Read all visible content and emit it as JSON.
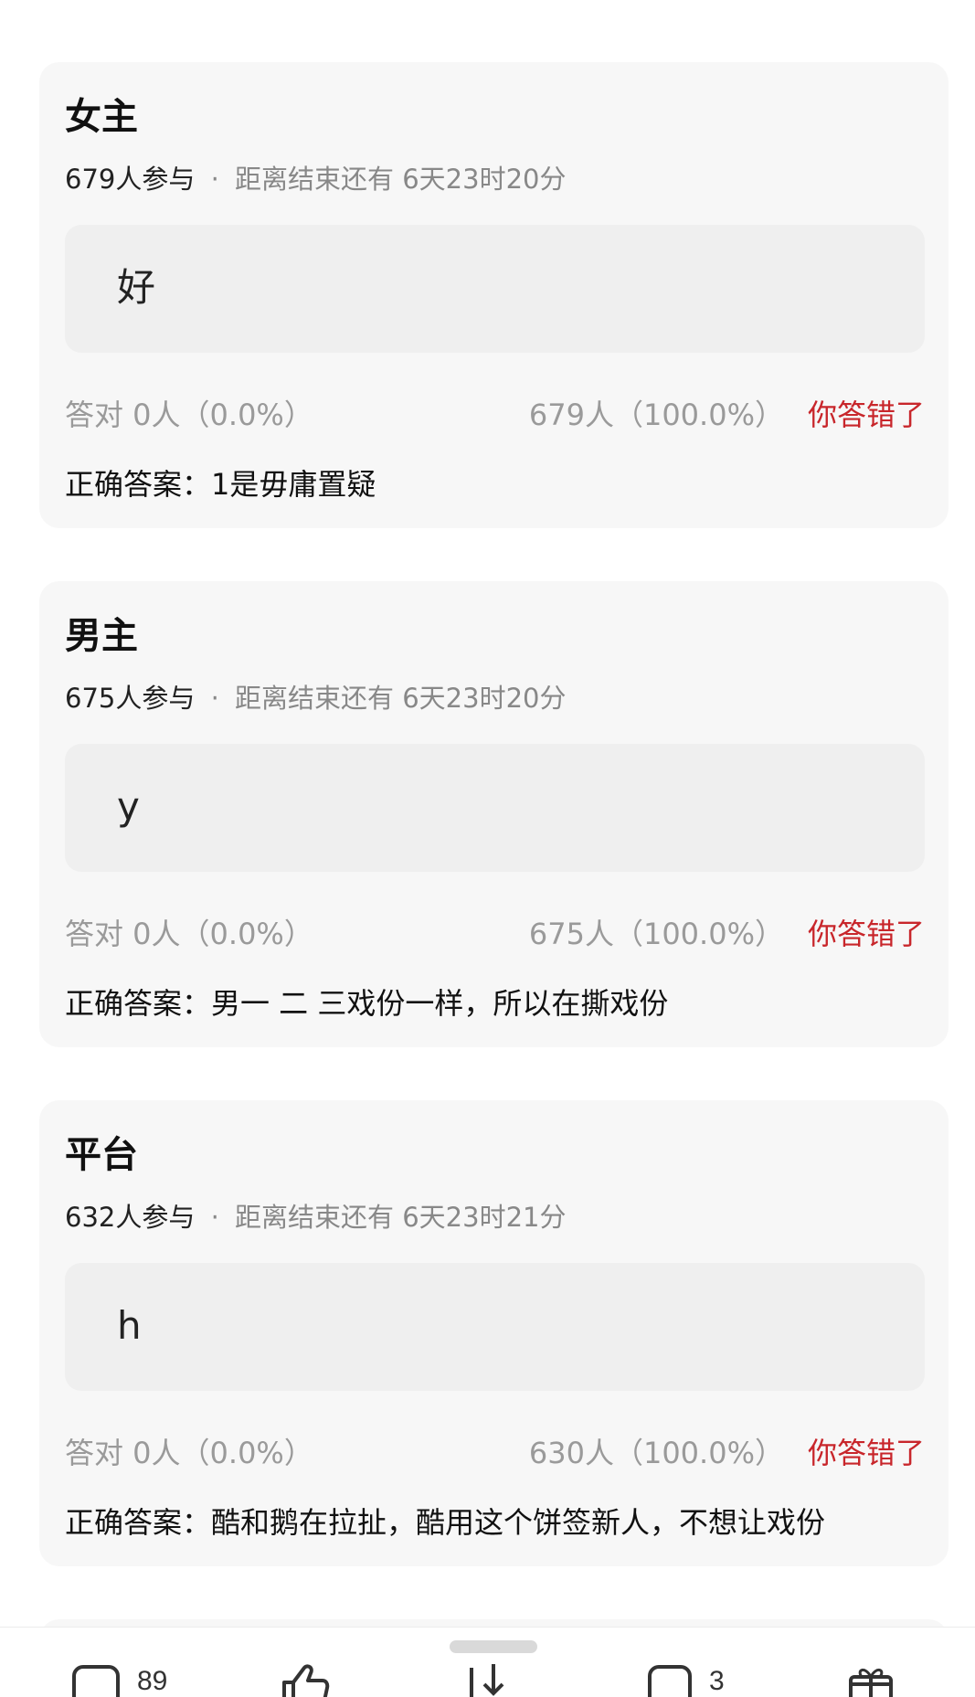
{
  "cards": [
    {
      "title": "女主",
      "participants": "679人参与",
      "separator": "·",
      "time_left": "距离结束还有 6天23时20分",
      "answer": "好",
      "correct_stat": "答对  0人（0.0%）",
      "wrong_stat": "679人（100.0%）",
      "result": "你答错了",
      "correct_answer": "正确答案：1是毋庸置疑"
    },
    {
      "title": "男主",
      "participants": "675人参与",
      "separator": "·",
      "time_left": "距离结束还有 6天23时20分",
      "answer": "y",
      "correct_stat": "答对  0人（0.0%）",
      "wrong_stat": "675人（100.0%）",
      "result": "你答错了",
      "correct_answer": "正确答案：男一 二 三戏份一样，所以在撕戏份"
    },
    {
      "title": "平台",
      "participants": "632人参与",
      "separator": "·",
      "time_left": "距离结束还有 6天23时21分",
      "answer": "h",
      "correct_stat": "答对  0人（0.0%）",
      "wrong_stat": "630人（100.0%）",
      "result": "你答错了",
      "correct_answer": "正确答案：酷和鹅在拉扯，酷用这个饼签新人，不想让戏份"
    }
  ],
  "bottom_bar": {
    "comment_count": "89",
    "forward_count": "3",
    "icons": [
      "comment-icon",
      "like-icon",
      "download-icon",
      "repost-icon",
      "gift-icon"
    ]
  },
  "colors": {
    "wrong_accent": "#c8262b",
    "card_bg": "#f7f7f7",
    "answer_bg": "#efefef"
  }
}
